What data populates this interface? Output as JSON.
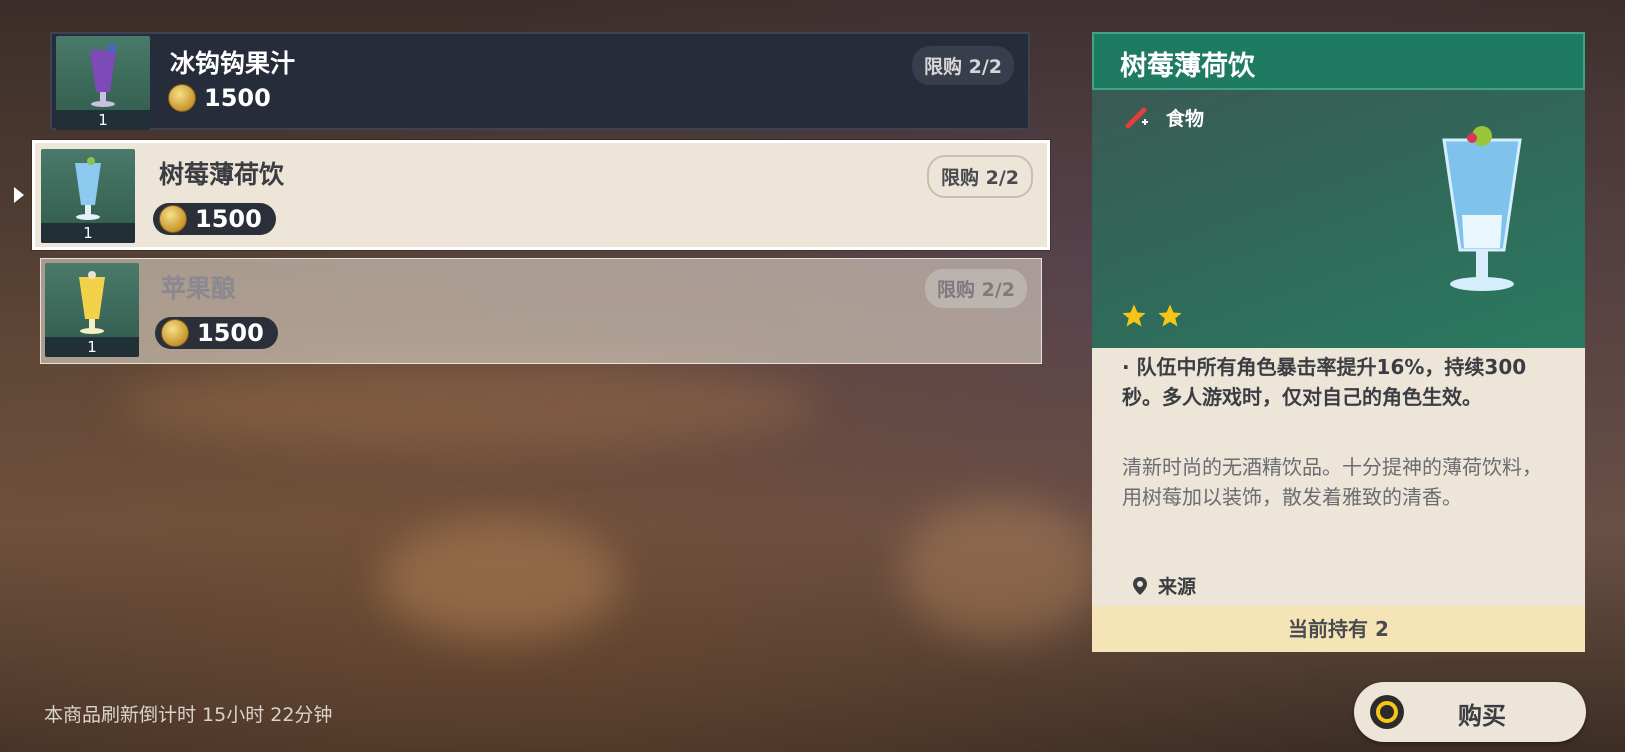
{
  "shop_items": [
    {
      "name": "冰钩钩果汁",
      "price": "1500",
      "limit": "限购 2/2",
      "qty": "1"
    },
    {
      "name": "树莓薄荷饮",
      "price": "1500",
      "limit": "限购 2/2",
      "qty": "1"
    },
    {
      "name": "苹果酿",
      "price": "1500",
      "limit": "限购 2/2",
      "qty": "1"
    }
  ],
  "detail": {
    "title": "树莓薄荷饮",
    "type": "食物",
    "rarity_stars": 2,
    "effect": "· 队伍中所有角色暴击率提升16%，持续300秒。多人游戏时，仅对自己的角色生效。",
    "description": "清新时尚的无酒精饮品。十分提神的薄荷饮料，用树莓加以装饰，散发着雅致的清香。",
    "source_label": "来源",
    "owned": "当前持有 2"
  },
  "refresh_text": "本商品刷新倒计时 15小时 22分钟",
  "buy_label": "购买",
  "icons": {
    "food_type": "food-icon",
    "location": "location-pin-icon",
    "buy": "controller-button-icon",
    "selection": "selection-arrow-icon"
  },
  "colors": {
    "header_green": "#1f7a62",
    "panel_bg": "#ece5d8",
    "star_gold": "#f5c518",
    "owned_bar": "#f5e4b5"
  }
}
